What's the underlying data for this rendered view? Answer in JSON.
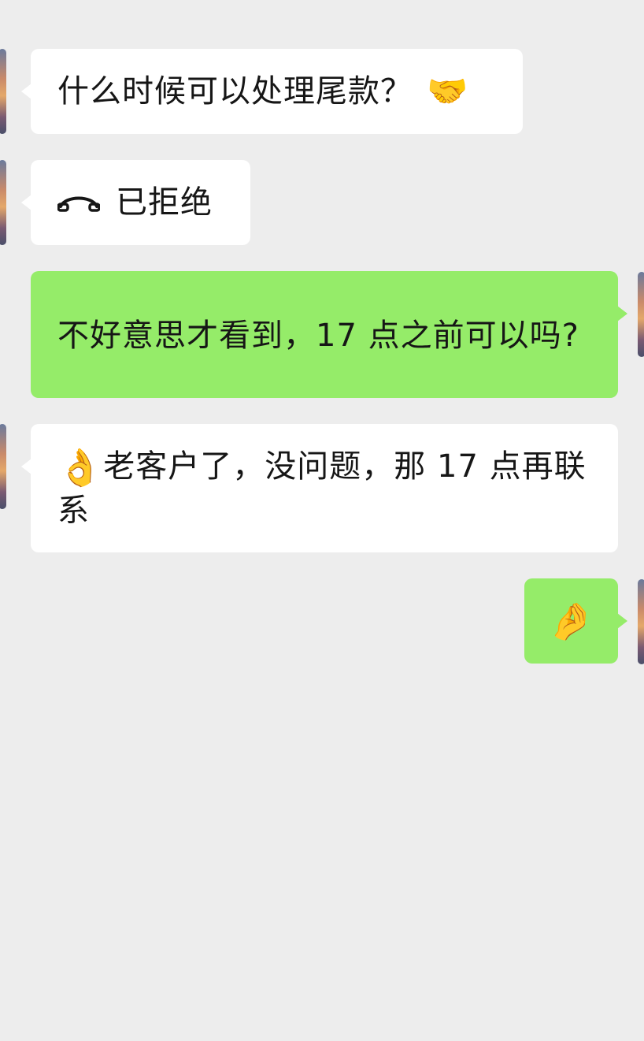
{
  "messages": [
    {
      "side": "left",
      "text": "什么时候可以处理尾款？",
      "emoji": "🤝",
      "emoji_name": "handshake-icon"
    },
    {
      "side": "left",
      "type": "call",
      "text": "已拒绝",
      "icon_name": "phone-hangup-icon"
    },
    {
      "side": "right",
      "text": "不好意思才看到，17 点之前可以吗?"
    },
    {
      "side": "left",
      "emoji": "👌",
      "emoji_name": "ok-hand-icon",
      "text": "老客户了，没问题，那 17 点再联系"
    },
    {
      "side": "right",
      "emoji": "🤌",
      "emoji_name": "pinched-fingers-icon"
    }
  ],
  "colors": {
    "background": "#ededed",
    "incoming_bubble": "#ffffff",
    "outgoing_bubble": "#95ec69",
    "text": "#161616"
  }
}
